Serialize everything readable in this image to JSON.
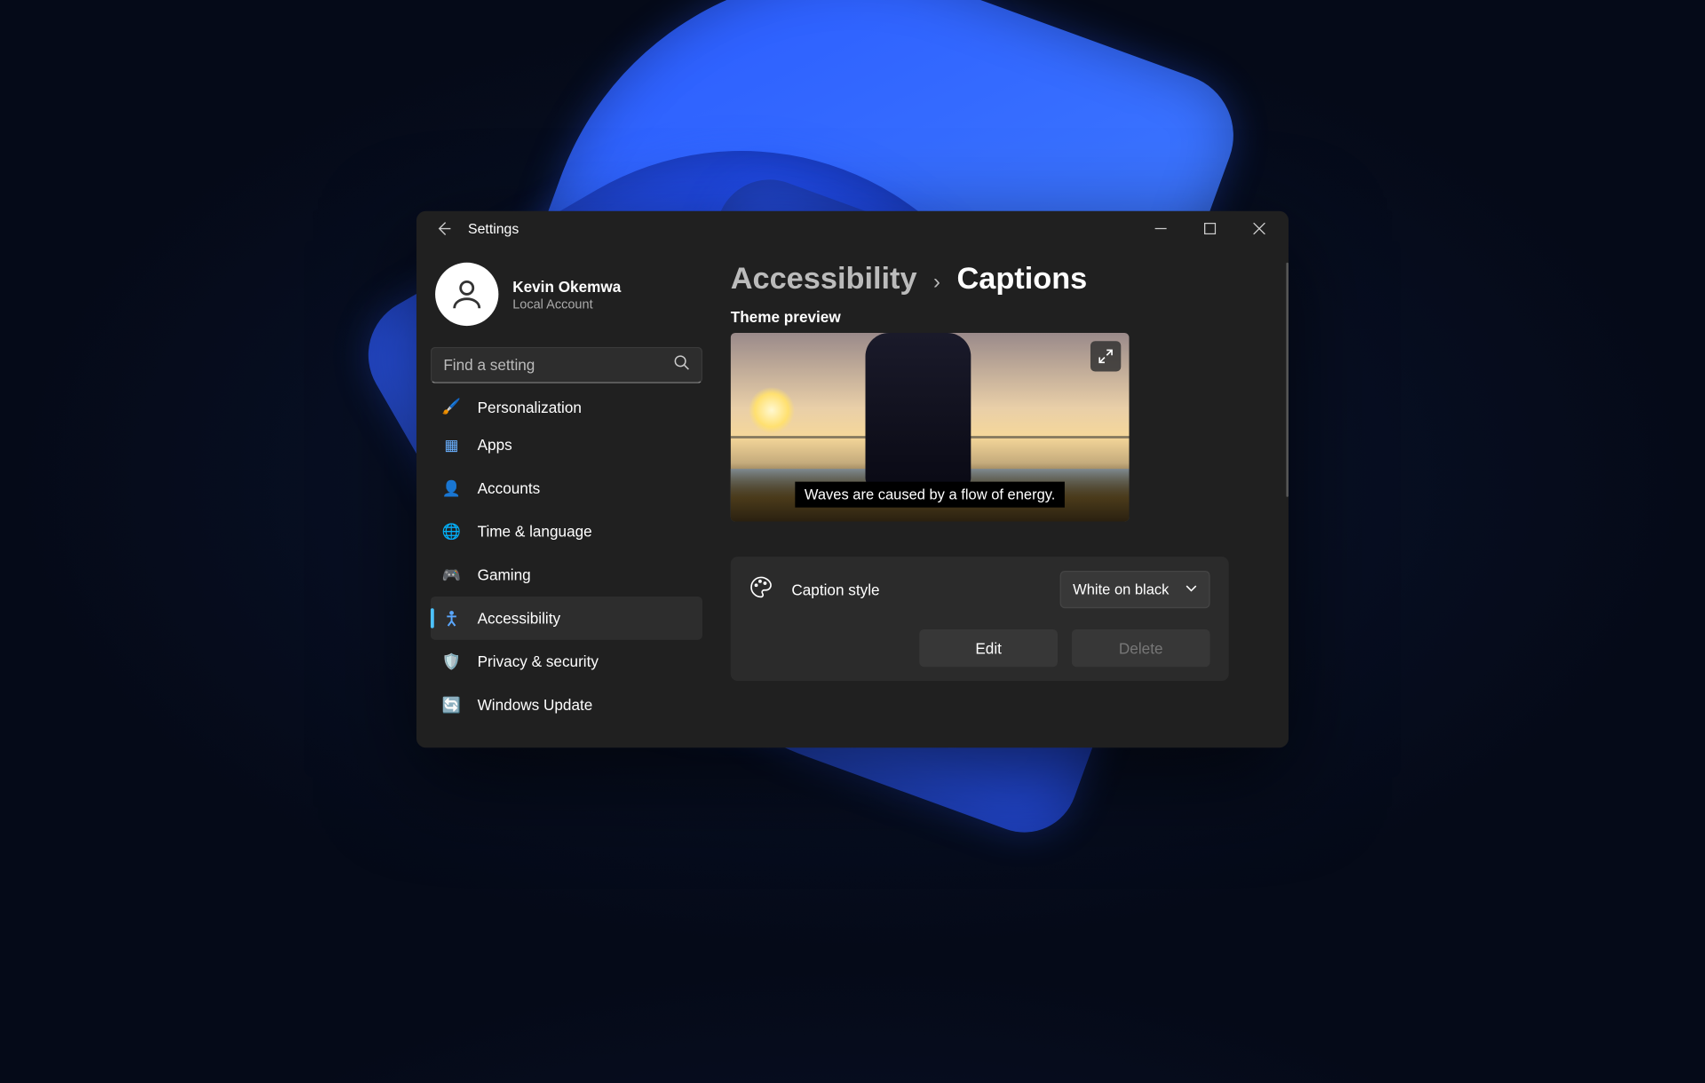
{
  "window": {
    "title": "Settings"
  },
  "profile": {
    "name": "Kevin Okemwa",
    "subtitle": "Local Account"
  },
  "search": {
    "placeholder": "Find a setting"
  },
  "nav": {
    "items": [
      {
        "icon": "🖌️",
        "label": "Personalization"
      },
      {
        "icon": "▦",
        "label": "Apps"
      },
      {
        "icon": "👤",
        "label": "Accounts"
      },
      {
        "icon": "🌐",
        "label": "Time & language"
      },
      {
        "icon": "🎮",
        "label": "Gaming"
      },
      {
        "icon": "✶",
        "label": "Accessibility"
      },
      {
        "icon": "🛡️",
        "label": "Privacy & security"
      },
      {
        "icon": "🔄",
        "label": "Windows Update"
      }
    ],
    "selected_index": 5
  },
  "breadcrumb": {
    "parent": "Accessibility",
    "sep": "›",
    "current": "Captions"
  },
  "preview": {
    "section_label": "Theme preview",
    "caption_text": "Waves are caused by a flow of energy."
  },
  "caption_style": {
    "label": "Caption style",
    "selected": "White on black",
    "edit_label": "Edit",
    "delete_label": "Delete"
  },
  "colors": {
    "accent": "#4cc2ff",
    "window_bg": "#202020",
    "card_bg": "#2b2b2b"
  }
}
